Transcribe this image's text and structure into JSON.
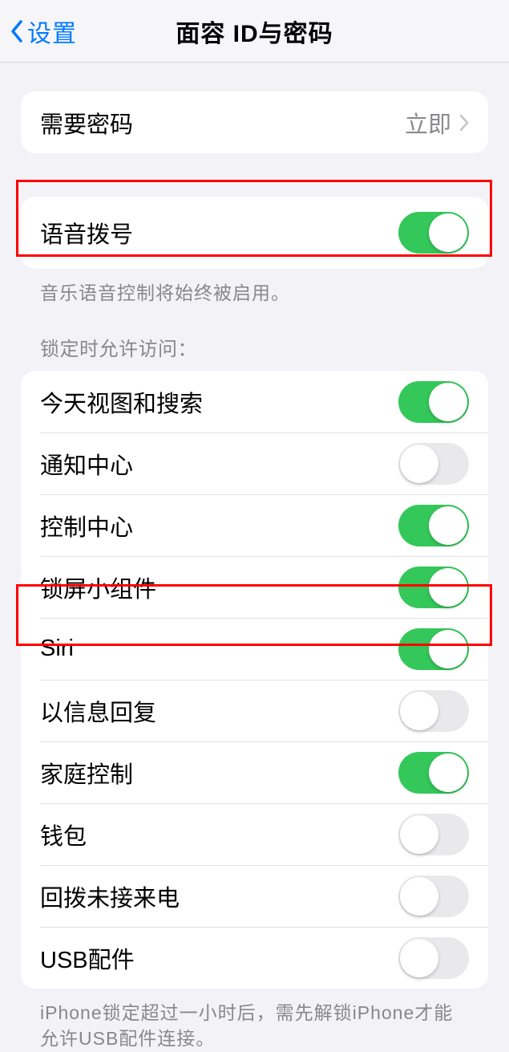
{
  "nav": {
    "back": "设置",
    "title": "面容 ID与密码"
  },
  "passcode": {
    "label": "需要密码",
    "value": "立即"
  },
  "voiceDial": {
    "label": "语音拨号",
    "on": true,
    "footer": "音乐语音控制将始终被启用。"
  },
  "lockAccess": {
    "header": "锁定时允许访问：",
    "items": [
      {
        "label": "今天视图和搜索",
        "on": true
      },
      {
        "label": "通知中心",
        "on": false
      },
      {
        "label": "控制中心",
        "on": true
      },
      {
        "label": "锁屏小组件",
        "on": true
      },
      {
        "label": "Siri",
        "on": true
      },
      {
        "label": "以信息回复",
        "on": false
      },
      {
        "label": "家庭控制",
        "on": true
      },
      {
        "label": "钱包",
        "on": false
      },
      {
        "label": "回拨未接来电",
        "on": false
      },
      {
        "label": "USB配件",
        "on": false
      }
    ],
    "footer": "iPhone锁定超过一小时后，需先解锁iPhone才能允许USB配件连接。"
  }
}
